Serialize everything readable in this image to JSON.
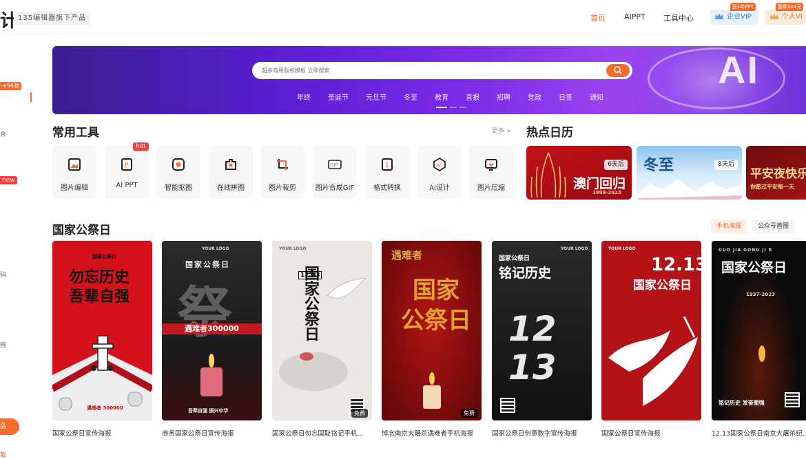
{
  "header": {
    "logo_glyph": "计",
    "tagline": "135编辑器旗下产品",
    "nav": [
      "首页",
      "AIPPT",
      "工具中心"
    ],
    "vip_enterprise": {
      "label": "企业VIP",
      "badge": "送1年PPT"
    },
    "vip_personal": {
      "label": "个人VI",
      "badge": "直降324元"
    }
  },
  "sidebar": {
    "badge_count": "+94张",
    "badge_new": "new",
    "fragments": [
      "合",
      "码",
      "画",
      "品",
      "截"
    ]
  },
  "banner": {
    "search_placeholder": "超多商用版权模板 立即搜索",
    "tags": [
      "年终",
      "圣诞节",
      "元旦节",
      "冬至",
      "教育",
      "喜报",
      "招聘",
      "党政",
      "日签",
      "通知"
    ],
    "art_text": "AI"
  },
  "tools": {
    "title": "常用工具",
    "more": "更多 >",
    "hot_badge": "hot",
    "items": [
      {
        "label": "图片编辑",
        "icon": "image-edit-icon"
      },
      {
        "label": "AI PPT",
        "icon": "ai-ppt-icon"
      },
      {
        "label": "智能抠图",
        "icon": "smart-cutout-icon"
      },
      {
        "label": "在线拼图",
        "icon": "puzzle-icon"
      },
      {
        "label": "图片裁剪",
        "icon": "crop-icon"
      },
      {
        "label": "图片合成GIF",
        "icon": "gif-icon"
      },
      {
        "label": "格式转换",
        "icon": "convert-icon"
      },
      {
        "label": "AI设计",
        "icon": "ai-design-icon"
      },
      {
        "label": "图片压缩",
        "icon": "compress-icon"
      }
    ]
  },
  "calendar": {
    "title": "热点日历",
    "cards": [
      {
        "days": "6天后",
        "text": "澳门回归",
        "sub": "1999-2023"
      },
      {
        "days": "8天后",
        "text": "冬至"
      },
      {
        "text": "平安夜快乐",
        "sub": "你愿过平安每一天"
      }
    ]
  },
  "memorial": {
    "title": "国家公祭日",
    "filter_tabs": [
      "手机海报",
      "公众号首图"
    ],
    "free_label": "免费",
    "posters": [
      {
        "caption": "国家公祭日宣传海报",
        "big": "勿忘历史\n吾辈自强",
        "top": "国家公祭日",
        "foot": "遇难者 300000"
      },
      {
        "caption": "商务国家公祭日宣传海报",
        "big": "祭",
        "top": "国家公祭日",
        "band": "遇难者300000",
        "foot": "吾辈自强 振兴中华",
        "logo": "YOUR LOGO"
      },
      {
        "caption": "国家公祭日勿忘国耻铭记手机...",
        "big": "国家公祭日",
        "num": "12.13",
        "logo": "YOUR LOGO"
      },
      {
        "caption": "悼念南京大屠杀遇难者手机海报",
        "big": "国家\n公祭日",
        "top": "遇难者"
      },
      {
        "caption": "国家公祭日创意数字宣传海报",
        "top": "国家公祭日",
        "big": "铭记历史",
        "num": "12\n13",
        "logo": "YOUR LOGO"
      },
      {
        "caption": "国家公祭日宣传海报",
        "num": "12.13",
        "big": "国家公祭日",
        "logo": "YOUR LOGO"
      },
      {
        "caption": "12.13国家公祭日南京大屠杀纪...",
        "top": "GUO JIA GONG JI R",
        "big": "国家公祭日",
        "years": "1937-2023",
        "foot": "铭记历史 发奋图强"
      }
    ]
  },
  "colors": {
    "accent": "#f56c2d",
    "banner_start": "#3a1f8f",
    "banner_end": "#9b44f0",
    "poster_red": "#d0121b"
  }
}
